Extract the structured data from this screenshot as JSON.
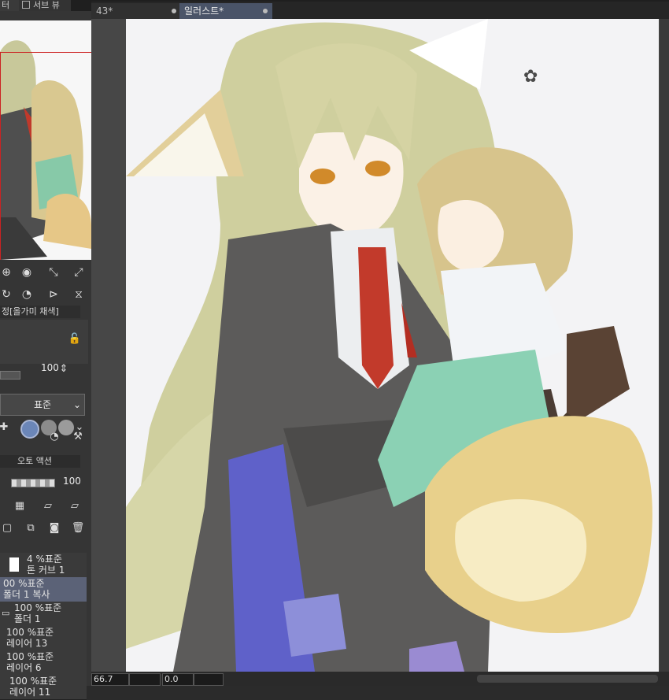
{
  "left_tabs": {
    "tab_a": "터",
    "tab_b": "서브 뷰"
  },
  "doc_tabs": [
    {
      "label": "43*"
    },
    {
      "label": "일러스트*"
    }
  ],
  "tool_property": {
    "panel_title": "정[올가미 채색]",
    "size_value": "100",
    "blend_mode": "표준"
  },
  "layer_panel": {
    "title": "오토 액션",
    "opacity_value": "100"
  },
  "layers": [
    {
      "line1": "4 %표준",
      "line2": "톤 커브 1",
      "selected": false
    },
    {
      "line1": "00 %표준",
      "line2": "폴더 1 복사",
      "selected": true
    },
    {
      "line1": "100 %표준",
      "line2": "폴더 1",
      "selected": false
    },
    {
      "line1": "100 %표준",
      "line2": "레이어 13",
      "selected": false
    },
    {
      "line1": "100 %표준",
      "line2": "레이어 6",
      "selected": false
    },
    {
      "line1": "100 %표준",
      "line2": "레이어 11",
      "selected": false
    }
  ],
  "status": {
    "zoom": "66.7",
    "rotation": "0.0"
  },
  "icons": {
    "tools": [
      "zoom-in-icon",
      "stop-icon",
      "fit-icon",
      "expand-icon",
      "rotate-icon",
      "timer-icon",
      "flip-h-icon",
      "flip-v-icon"
    ]
  }
}
